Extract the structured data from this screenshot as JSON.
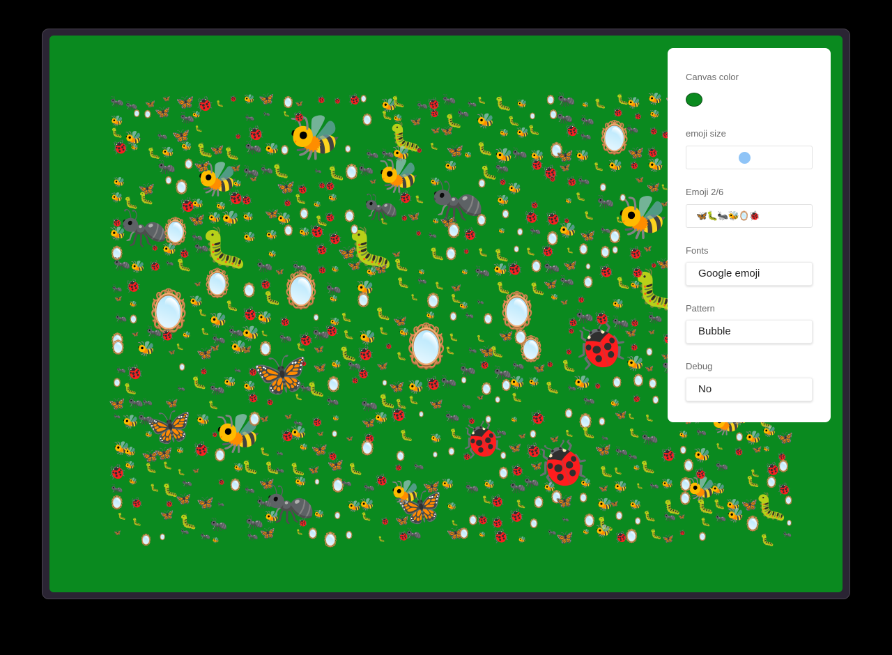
{
  "colors": {
    "canvas": "#0a8a1f",
    "frame": "#2a2433",
    "panel": "#ffffff",
    "slider_thumb": "#8fc4f7"
  },
  "panel": {
    "canvas_color_label": "Canvas color",
    "canvas_color_value": "#0a8a1f",
    "emoji_size_label": "emoji size",
    "emoji_size_level": 0.5,
    "emoji_label": "Emoji 2/6",
    "emoji_value": "🦋🐛🐜🐝🪞🐞",
    "fonts_label": "Fonts",
    "fonts_value": "Google emoji",
    "pattern_label": "Pattern",
    "pattern_value": "Bubble",
    "debug_label": "Debug",
    "debug_value": "No"
  },
  "canvas": {
    "emoji_set": [
      "🦋",
      "🐛",
      "🐜",
      "🐝",
      "🪞",
      "🐞"
    ]
  }
}
